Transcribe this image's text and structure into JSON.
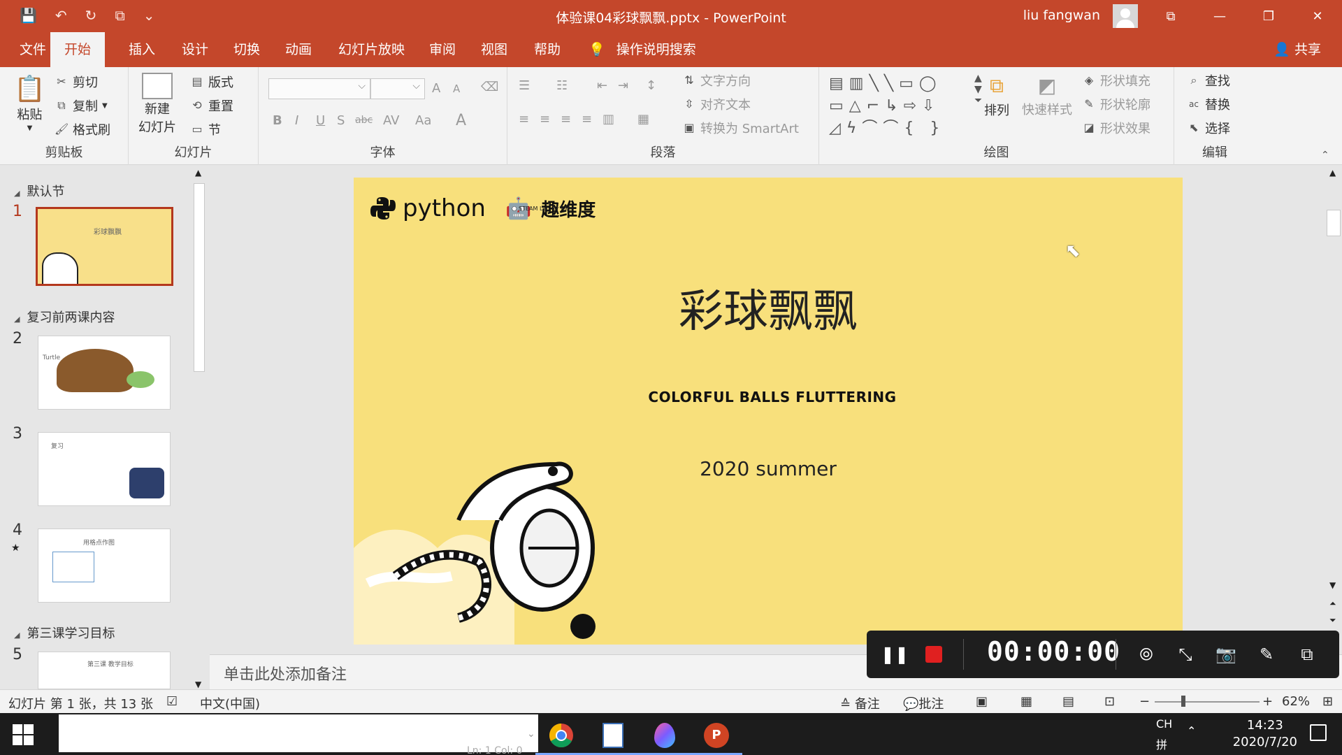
{
  "titlebar": {
    "qat": [
      "💾",
      "↶",
      "↻",
      "⧉",
      "⌄"
    ],
    "title": "体验课04彩球飘飘.pptx  -  PowerPoint",
    "user": "liu fangwan",
    "window_buttons": [
      "⧉",
      "—",
      "❐",
      "✕"
    ]
  },
  "menu": {
    "tabs": [
      "文件",
      "开始",
      "插入",
      "设计",
      "切换",
      "动画",
      "幻灯片放映",
      "审阅",
      "视图",
      "帮助"
    ],
    "search": "操作说明搜索",
    "share": "共享"
  },
  "ribbon": {
    "clipboard": {
      "paste": "粘贴",
      "cut": "剪切",
      "copy": "复制",
      "format_painter": "格式刷",
      "label": "剪贴板"
    },
    "slides": {
      "new_slide_1": "新建",
      "new_slide_2": "幻灯片",
      "layout": "版式",
      "reset": "重置",
      "section": "节",
      "label": "幻灯片"
    },
    "font": {
      "label": "字体",
      "bold": "B",
      "italic": "I",
      "underline": "U",
      "shadow": "S",
      "strike": "abc",
      "spacing": "AV",
      "case": "Aa",
      "color": "A",
      "grow": "A",
      "shrink": "A"
    },
    "paragraph": {
      "text_direction": "文字方向",
      "align_text": "对齐文本",
      "smartart": "转换为 SmartArt",
      "label": "段落"
    },
    "drawing": {
      "arrange": "排列",
      "quick_styles": "快速样式",
      "shape_fill": "形状填充",
      "shape_outline": "形状轮廓",
      "shape_effects": "形状效果",
      "label": "绘图"
    },
    "editing": {
      "find": "查找",
      "replace": "替换",
      "select": "选择",
      "label": "编辑"
    }
  },
  "thumbnails": {
    "sections": [
      "默认节",
      "复习前两课内容",
      "第三课学习目标"
    ],
    "slides": [
      {
        "num": "1",
        "mini_title": "彩球飘飘"
      },
      {
        "num": "2",
        "mini_title": "Turtle"
      },
      {
        "num": "3",
        "mini_title": "复习"
      },
      {
        "num": "4",
        "mini_title": "用格点作图"
      },
      {
        "num": "5",
        "mini_title": "第三课 教学目标"
      }
    ]
  },
  "slide": {
    "brand": "python",
    "brand2": "趣维度",
    "brand2_sub": "STEAM Lab for Kids",
    "title": "彩球飘飘",
    "subtitle": "COLORFUL BALLS FLUTTERING",
    "date": "2020 summer"
  },
  "notes": {
    "placeholder": "单击此处添加备注"
  },
  "recorder": {
    "time": "00:00:00"
  },
  "statusbar": {
    "slide_info": "幻灯片 第 1 张，共 13 张",
    "language": "中文(中国)",
    "notes": "备注",
    "comments": "批注",
    "zoom": "62%"
  },
  "taskbar": {
    "lang": "CH",
    "ime": "拼",
    "time": "14:23",
    "date": "2020/7/20",
    "behind_text": "Ln: 1  Col: 0"
  },
  "colors": {
    "accent": "#c4472b",
    "slide_bg": "#f8e07c"
  }
}
